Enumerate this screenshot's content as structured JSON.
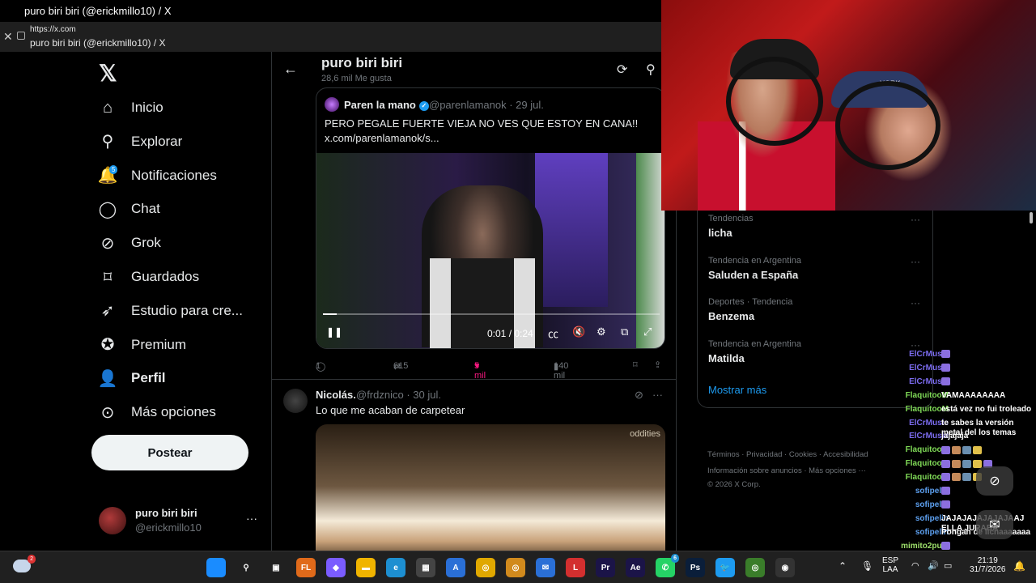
{
  "window": {
    "title": "puro biri biri (@erickmillo10) / X",
    "url": "https://x.com",
    "tab_title": "puro biri biri (@erickmillo10) / X"
  },
  "sidebar": {
    "logo": "𝕏",
    "items": [
      {
        "label": "Inicio",
        "icon": "home-icon",
        "glyph": "⌂"
      },
      {
        "label": "Explorar",
        "icon": "search-icon",
        "glyph": "⚲"
      },
      {
        "label": "Notificaciones",
        "icon": "bell-icon",
        "glyph": "🔔",
        "badge": "5"
      },
      {
        "label": "Chat",
        "icon": "chat-icon",
        "glyph": "◯"
      },
      {
        "label": "Grok",
        "icon": "grok-icon",
        "glyph": "⊘"
      },
      {
        "label": "Guardados",
        "icon": "bookmark-icon",
        "glyph": "⌑"
      },
      {
        "label": "Estudio para cre...",
        "icon": "rocket-icon",
        "glyph": "➶"
      },
      {
        "label": "Premium",
        "icon": "premium-icon",
        "glyph": "✪"
      },
      {
        "label": "Perfil",
        "icon": "person-icon",
        "glyph": "👤"
      },
      {
        "label": "Más opciones",
        "icon": "more-icon",
        "glyph": "⊙"
      }
    ],
    "post_label": "Postear",
    "account": {
      "name": "puro biri biri",
      "handle": "@erickmillo10",
      "more": "···"
    }
  },
  "main": {
    "header": {
      "title": "puro biri biri",
      "subtitle": "28,6 mil Me gusta"
    },
    "quote": {
      "author": "Paren la mano",
      "handle": "@parenlamanok · 29 jul.",
      "text_line1": "PERO PEGALE FUERTE VIEJA NO VES QUE ESTOY EN CANA!!",
      "text_line2": "x.com/parenlamanok/s...",
      "video": {
        "time": "0:01 / 0:24",
        "progress": 0.04
      }
    },
    "actions": {
      "replies": "1",
      "reposts": "615",
      "likes": "5 mil",
      "views": "140 mil"
    },
    "tweet2": {
      "author": "Nicolás.",
      "handle": "@frdznico · 30 jul.",
      "text": "Lo que me acaban de carpetear",
      "watermark": "oddities"
    }
  },
  "trends": {
    "items": [
      {
        "context": "Tendencias",
        "name": "licha"
      },
      {
        "context": "Tendencia en Argentina",
        "name": "Saluden a España"
      },
      {
        "context": "Deportes · Tendencia",
        "name": "Benzema"
      },
      {
        "context": "Tendencia en Argentina",
        "name": "Matilda"
      }
    ],
    "more_label": "Mostrar más",
    "more_dots": "···"
  },
  "footer": {
    "line1": "Términos  ·  Privacidad  ·  Cookies  ·  Accesibilidad",
    "line2": "Información sobre anuncios  ·  Más opciones ···",
    "line3": "© 2026 X Corp."
  },
  "webcam": {
    "cap_text": "YORK"
  },
  "chat": {
    "messages": [
      {
        "user": "ElCrMusic",
        "text": "",
        "color": "#7c6cf0",
        "emotes": 1
      },
      {
        "user": "ElCrMusic",
        "text": "",
        "color": "#7c6cf0",
        "emotes": 1
      },
      {
        "user": "ElCrMusic",
        "text": "",
        "color": "#7c6cf0",
        "emotes": 1
      },
      {
        "user": "FlaquitooM",
        "text": "VAMAAAAAAAA",
        "color": "#7fd957"
      },
      {
        "user": "FlaquitooM",
        "text": "está vez no fui troleado",
        "color": "#7fd957"
      },
      {
        "user": "ElCrMusic",
        "text": "te sabes la versión metal del los temas",
        "color": "#7c6cf0"
      },
      {
        "user": "ElCrMusic",
        "text": "jajajaja",
        "color": "#7c6cf0"
      },
      {
        "user": "FlaquitooM",
        "text": "",
        "color": "#7fd957",
        "emotes": 4
      },
      {
        "user": "FlaquitooM",
        "text": "",
        "color": "#7fd957",
        "emotes": 5
      },
      {
        "user": "FlaquitooM",
        "text": "",
        "color": "#7fd957",
        "emotes": 4
      },
      {
        "user": "sofipelin",
        "text": "",
        "color": "#5da0f0",
        "emotes": 1
      },
      {
        "user": "sofipelin",
        "text": "",
        "color": "#5da0f0",
        "emotes": 1
      },
      {
        "user": "sofipelin",
        "text": "JAJAJAJAJAJAJAAJ ELLA JURABA",
        "color": "#5da0f0"
      },
      {
        "user": "sofipelin",
        "text": "Pongan de lichaaaaaaa",
        "color": "#5da0f0"
      },
      {
        "user": "mimito2pu...",
        "text": "",
        "color": "#9ee06b",
        "emotes": 1
      }
    ]
  },
  "taskbar": {
    "notif_badge": "2",
    "apps": [
      {
        "icon": "windows-icon",
        "label": "",
        "color": "#1a8cff"
      },
      {
        "icon": "search-icon",
        "label": "⚲",
        "color": "#202020"
      },
      {
        "icon": "taskview-icon",
        "label": "▣",
        "color": "#202020"
      },
      {
        "icon": "fl-studio-icon",
        "label": "FL",
        "color": "#e06a1a"
      },
      {
        "icon": "copilot-icon",
        "label": "◆",
        "color": "#7a5cff"
      },
      {
        "icon": "file-explorer-icon",
        "label": "▬",
        "color": "#f0b400"
      },
      {
        "icon": "edge-icon",
        "label": "e",
        "color": "#1d8fd1"
      },
      {
        "icon": "store-icon",
        "label": "▦",
        "color": "#444"
      },
      {
        "icon": "vector-icon",
        "label": "A",
        "color": "#2a6fd6"
      },
      {
        "icon": "chrome-icon",
        "label": "◎",
        "color": "#e0a800"
      },
      {
        "icon": "chrome-canary-icon",
        "label": "◎",
        "color": "#d18a1d"
      },
      {
        "icon": "mail-icon",
        "label": "✉",
        "color": "#2a6fd6"
      },
      {
        "icon": "lastpass-icon",
        "label": "L",
        "color": "#d32f2f"
      },
      {
        "icon": "premiere-icon",
        "label": "Pr",
        "color": "#1b1448"
      },
      {
        "icon": "after-effects-icon",
        "label": "Ae",
        "color": "#1b1448"
      },
      {
        "icon": "whatsapp-icon",
        "label": "✆",
        "color": "#25d366",
        "badge": "6"
      },
      {
        "icon": "photoshop-icon",
        "label": "Ps",
        "color": "#0a1e3a"
      },
      {
        "icon": "twitter-icon",
        "label": "🐦",
        "color": "#1d9bf0"
      },
      {
        "icon": "chrome-icon-2",
        "label": "◎",
        "color": "#3a7d2a"
      },
      {
        "icon": "obs-icon",
        "label": "◉",
        "color": "#333"
      }
    ],
    "lang1": "ESP",
    "lang2": "LAA",
    "time": "21:19",
    "date": "31/7/2026"
  }
}
